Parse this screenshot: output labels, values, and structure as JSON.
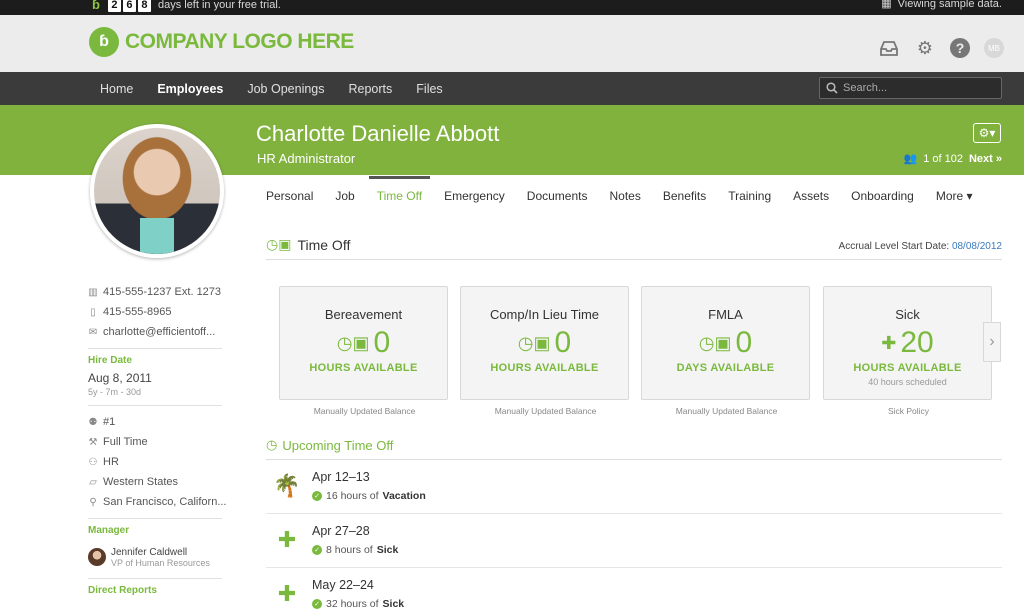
{
  "trial": {
    "digits": [
      "2",
      "6",
      "8"
    ],
    "text": "days left in your free trial.",
    "sample_text": "Viewing sample data."
  },
  "brand": {
    "logo_text": "COMPANY LOGO HERE",
    "avatar_initials": "MB"
  },
  "nav": {
    "items": [
      "Home",
      "Employees",
      "Job Openings",
      "Reports",
      "Files"
    ],
    "active": "Employees",
    "search_placeholder": "Search..."
  },
  "profile": {
    "name": "Charlotte Danielle Abbott",
    "title": "HR Administrator",
    "position_counter": "1 of 102",
    "next_label": "Next »"
  },
  "contact": {
    "work_phone": "415-555-1237 Ext. 1273",
    "mobile_phone": "415-555-8965",
    "email": "charlotte@efficientoff..."
  },
  "hire": {
    "label": "Hire Date",
    "date": "Aug 8, 2011",
    "tenure": "5y - 7m - 30d"
  },
  "job_info": {
    "employee_number": "#1",
    "employment_type": "Full Time",
    "department": "HR",
    "division": "Western States",
    "location": "San Francisco, Californ..."
  },
  "manager": {
    "label": "Manager",
    "name": "Jennifer Caldwell",
    "title": "VP of Human Resources"
  },
  "direct_reports_label": "Direct Reports",
  "tabs": [
    "Personal",
    "Job",
    "Time Off",
    "Emergency",
    "Documents",
    "Notes",
    "Benefits",
    "Training",
    "Assets",
    "Onboarding",
    "More ▾"
  ],
  "active_tab": "Time Off",
  "time_off": {
    "title": "Time Off",
    "accrual_label": "Accrual Level Start Date:",
    "accrual_date": "08/08/2012",
    "cards": [
      {
        "title": "Bereavement",
        "value": "0",
        "unit": "HOURS AVAILABLE",
        "note": "",
        "footer": "Manually Updated Balance",
        "icon": "calendar-clock-icon"
      },
      {
        "title": "Comp/In Lieu Time",
        "value": "0",
        "unit": "HOURS AVAILABLE",
        "note": "",
        "footer": "Manually Updated Balance",
        "icon": "calendar-clock-icon"
      },
      {
        "title": "FMLA",
        "value": "0",
        "unit": "DAYS AVAILABLE",
        "note": "",
        "footer": "Manually Updated Balance",
        "icon": "calendar-clock-icon"
      },
      {
        "title": "Sick",
        "value": "20",
        "unit": "HOURS AVAILABLE",
        "note": "40 hours scheduled",
        "footer": "Sick Policy",
        "icon": "bandage-icon"
      }
    ]
  },
  "upcoming": {
    "title": "Upcoming Time Off",
    "items": [
      {
        "date": "Apr 12–13",
        "amount": "16 hours of",
        "type": "Vacation",
        "icon": "palm-tree-icon"
      },
      {
        "date": "Apr 27–28",
        "amount": "8 hours of",
        "type": "Sick",
        "icon": "bandage-icon"
      },
      {
        "date": "May 22–24",
        "amount": "32 hours of",
        "type": "Sick",
        "icon": "bandage-icon"
      }
    ]
  },
  "colors": {
    "brand_green": "#82b23e",
    "accent_green": "#7ab93d",
    "nav_bg": "#3b3b3b",
    "link_blue": "#3a7abf"
  }
}
